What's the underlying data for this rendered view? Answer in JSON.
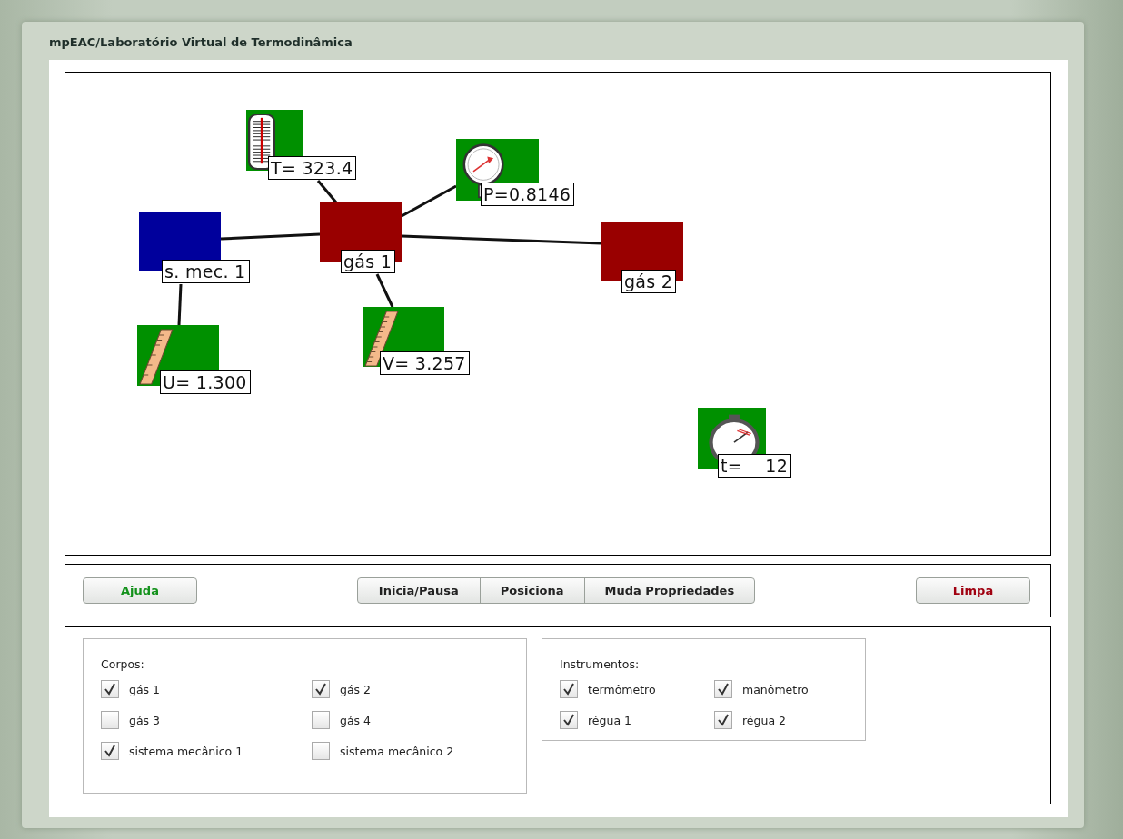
{
  "window": {
    "title": "mpEAC/Laboratório Virtual de Termodinâmica"
  },
  "canvas": {
    "nodes": [
      {
        "kind": "thermometer",
        "label": "T= 323.4"
      },
      {
        "kind": "manometer",
        "label": "P=0.8146"
      },
      {
        "kind": "body",
        "color": "#00009c",
        "label": "s. mec. 1"
      },
      {
        "kind": "body",
        "color": "#990000",
        "label": "gás 1"
      },
      {
        "kind": "body",
        "color": "#990000",
        "label": "gás 2"
      },
      {
        "kind": "ruler",
        "label": "U= 1.300"
      },
      {
        "kind": "ruler",
        "label": "V= 3.257"
      },
      {
        "kind": "stopwatch",
        "label": "t=    12"
      }
    ]
  },
  "toolbar": {
    "buttons": [
      {
        "kind": "help",
        "label": "Ajuda"
      },
      {
        "kind": "action",
        "label": "Inicia/Pausa"
      },
      {
        "kind": "action",
        "label": "Posiciona"
      },
      {
        "kind": "action",
        "label": "Muda Propriedades"
      },
      {
        "kind": "danger",
        "label": "Limpa"
      }
    ]
  },
  "groups": [
    {
      "title": "Corpos:",
      "items": [
        {
          "label": "gás 1",
          "checked": true
        },
        {
          "label": "gás 2",
          "checked": true
        },
        {
          "label": "gás 3",
          "checked": false
        },
        {
          "label": "gás 4",
          "checked": false
        },
        {
          "label": "sistema mecânico 1",
          "checked": true
        },
        {
          "label": "sistema mecânico 2",
          "checked": false
        }
      ]
    },
    {
      "title": "Instrumentos:",
      "items": [
        {
          "label": "termômetro",
          "checked": true
        },
        {
          "label": "manômetro",
          "checked": true
        },
        {
          "label": "régua 1",
          "checked": true
        },
        {
          "label": "régua 2",
          "checked": true
        }
      ]
    }
  ]
}
